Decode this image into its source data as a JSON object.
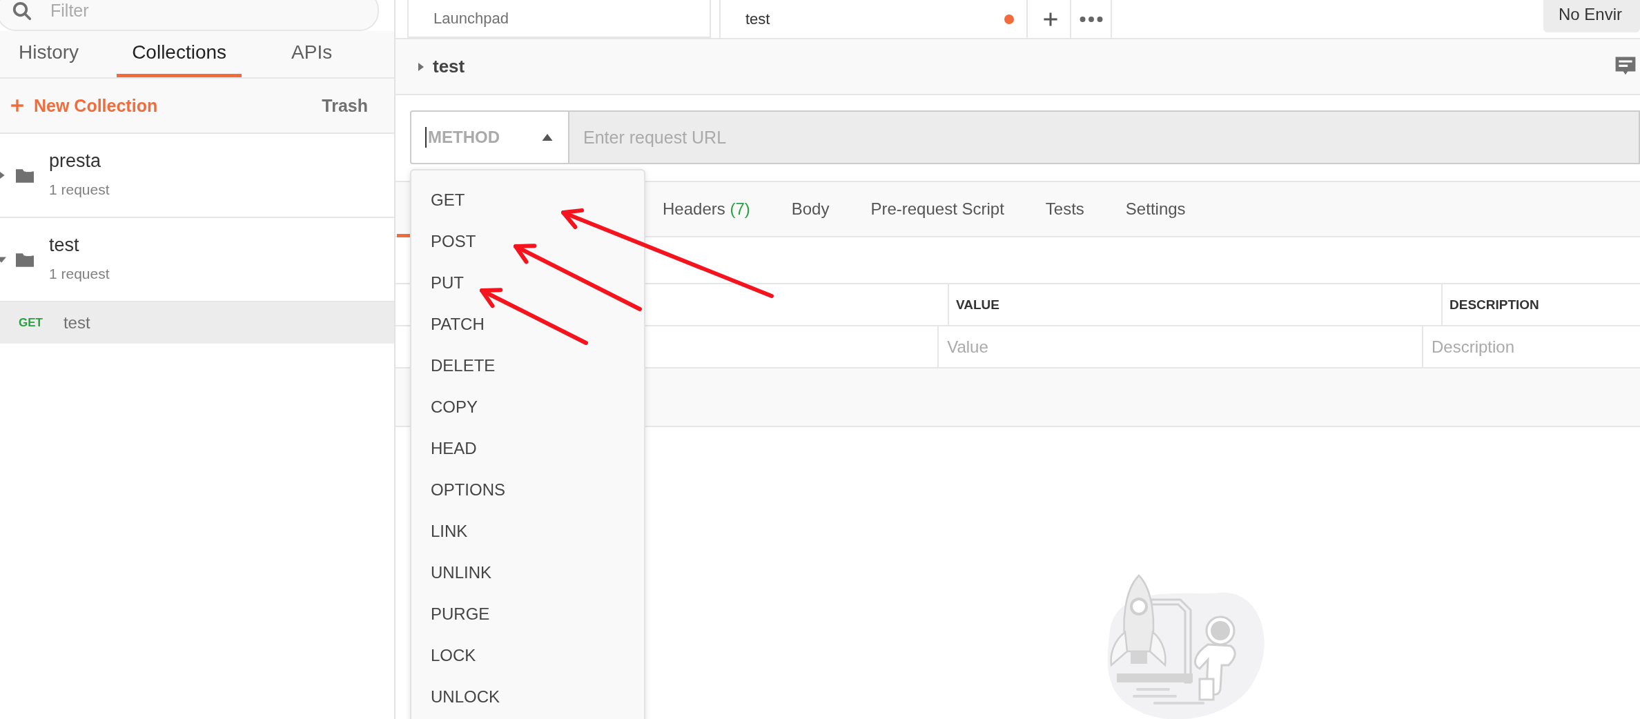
{
  "sidebar": {
    "filter": {
      "placeholder": "Filter"
    },
    "tabs": [
      {
        "label": "History",
        "selected": false
      },
      {
        "label": "Collections",
        "selected": true
      },
      {
        "label": "APIs",
        "selected": false
      }
    ],
    "new_collection": "New Collection",
    "trash": "Trash",
    "collections": [
      {
        "name": "presta",
        "count": "1 request",
        "expanded": false
      },
      {
        "name": "test",
        "count": "1 request",
        "expanded": true,
        "children": [
          {
            "method": "GET",
            "name": "test",
            "selected": true
          }
        ]
      }
    ]
  },
  "tabs": [
    {
      "label": "Launchpad",
      "selected": false,
      "unsaved": false
    },
    {
      "label": "test",
      "selected": true,
      "unsaved": true
    }
  ],
  "environment": "No Envir",
  "request": {
    "title": "test",
    "method": {
      "placeholder": "METHOD",
      "open": true
    },
    "url": {
      "placeholder": "Enter request URL"
    },
    "method_menu": [
      "GET",
      "POST",
      "PUT",
      "PATCH",
      "DELETE",
      "COPY",
      "HEAD",
      "OPTIONS",
      "LINK",
      "UNLINK",
      "PURGE",
      "LOCK",
      "UNLOCK"
    ],
    "tabs": [
      {
        "label": "Headers",
        "count": "(7)"
      },
      {
        "label": "Body"
      },
      {
        "label": "Pre-request Script"
      },
      {
        "label": "Tests"
      },
      {
        "label": "Settings"
      }
    ],
    "table": {
      "columns": [
        "VALUE",
        "DESCRIPTION"
      ],
      "rows": [
        [
          {
            "placeholder": "Value"
          },
          {
            "placeholder": "Description"
          }
        ]
      ]
    }
  },
  "annotations": [
    {
      "kind": "arrow"
    },
    {
      "kind": "arrow"
    },
    {
      "kind": "arrow"
    }
  ]
}
